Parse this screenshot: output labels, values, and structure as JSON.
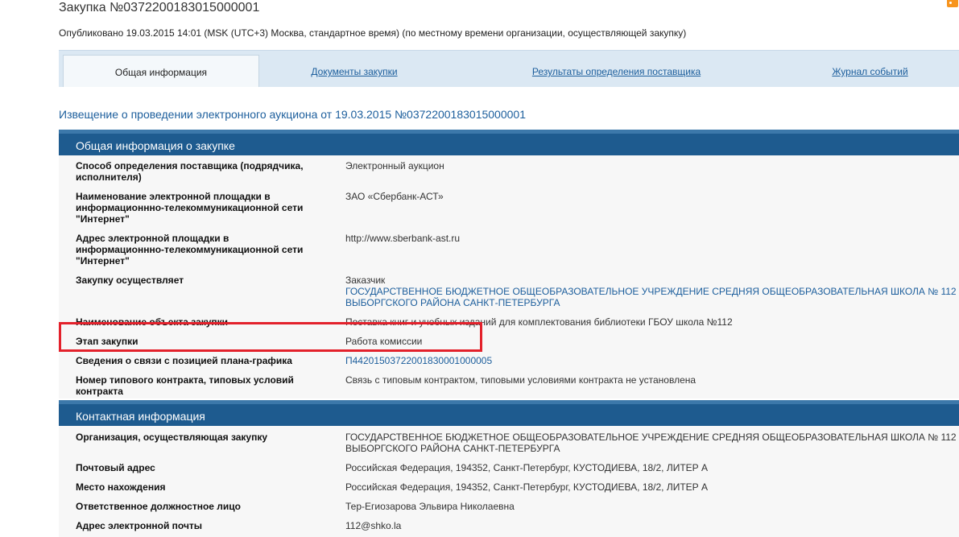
{
  "header": {
    "title": "Закупка №0372200183015000001",
    "published": "Опубликовано 19.03.2015 14:01 (MSK (UTC+3) Москва, стандартное время) (по местному времени организации, осуществляющей закупку)"
  },
  "tabs": {
    "general": "Общая информация",
    "documents": "Документы закупки",
    "results": "Результаты определения поставщика",
    "journal": "Журнал событий"
  },
  "notice": "Извещение о проведении электронного аукциона от 19.03.2015 №0372200183015000001",
  "general_section": {
    "title": "Общая информация о закупке",
    "method_label": "Способ определения поставщика (подрядчика, исполнителя)",
    "method_value": "Электронный аукцион",
    "platform_name_label": "Наименование электронной площадки в информационнно-телекоммуникационной сети \"Интернет\"",
    "platform_name_value": "ЗАО «Сбербанк-АСТ»",
    "platform_addr_label": "Адрес электронной площадки в информационнно-телекоммуникационной сети \"Интернет\"",
    "platform_addr_value": "http://www.sberbank-ast.ru",
    "performer_label": "Закупку осуществляет",
    "performer_role": "Заказчик",
    "performer_org": "ГОСУДАРСТВЕННОЕ БЮДЖЕТНОЕ ОБЩЕОБРАЗОВАТЕЛЬНОЕ УЧРЕЖДЕНИЕ СРЕДНЯЯ ОБЩЕОБРАЗОВАТЕЛЬНАЯ ШКОЛА № 112 ВЫБОРГСКОГО РАЙОНА САНКТ-ПЕТЕРБУРГА",
    "object_label": "Наименование объекта закупки",
    "object_value": "Поставка книг и учебных изданий для комплектования библиотеки ГБОУ школа №112",
    "stage_label": "Этап закупки",
    "stage_value": "Работа комиссии",
    "plan_label": "Сведения о связи с позицией плана-графика",
    "plan_value": "П44201503722001830001000005",
    "contract_label": "Номер типового контракта, типовых условий контракта",
    "contract_value": "Связь с типовым контрактом, типовыми условиями контракта не установлена"
  },
  "contact_section": {
    "title": "Контактная информация",
    "org_label": "Организация, осуществляющая закупку",
    "org_value": "ГОСУДАРСТВЕННОЕ БЮДЖЕТНОЕ ОБЩЕОБРАЗОВАТЕЛЬНОЕ УЧРЕЖДЕНИЕ СРЕДНЯЯ ОБЩЕОБРАЗОВАТЕЛЬНАЯ ШКОЛА № 112 ВЫБОРГСКОГО РАЙОНА САНКТ-ПЕТЕРБУРГА",
    "postal_label": "Почтовый адрес",
    "postal_value": "Российская Федерация, 194352, Санкт-Петербург, КУСТОДИЕВА, 18/2, ЛИТЕР А",
    "location_label": "Место нахождения",
    "location_value": "Российская Федерация, 194352, Санкт-Петербург, КУСТОДИЕВА, 18/2, ЛИТЕР А",
    "person_label": "Ответственное должностное лицо",
    "person_value": "Тер-Егиозарова Эльвира Николаевна",
    "email_label": "Адрес электронной почты",
    "email_value": "112@shko.la"
  },
  "colors": {
    "header_blue": "#1e5b8f",
    "link_blue": "#1c5e9c",
    "highlight_red": "#e3212b"
  }
}
